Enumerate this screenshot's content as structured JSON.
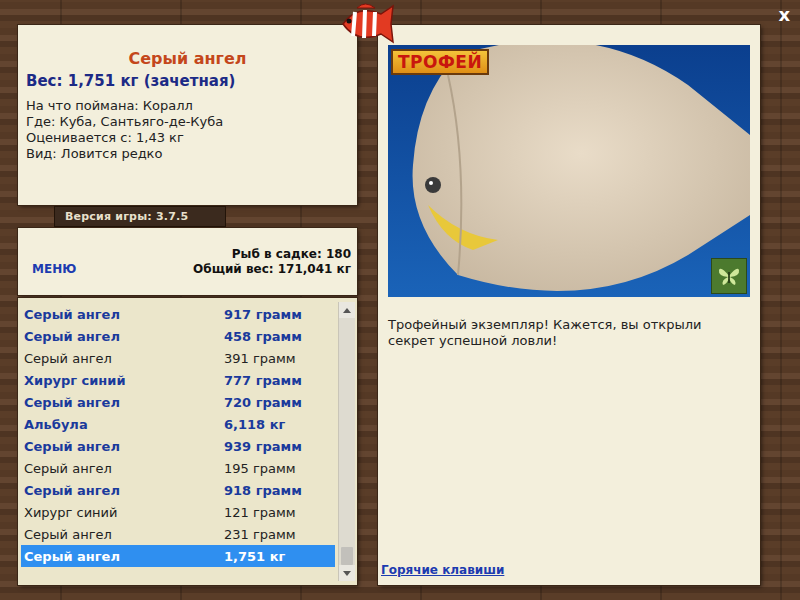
{
  "window": {
    "close": "x"
  },
  "catch": {
    "title": "Серый ангел",
    "weight": "Вес: 1,751 кг (зачетная)",
    "details": [
      "На что поймана: Коралл",
      "Где: Куба, Сантьяго-де-Куба",
      "Оценивается с: 1,43 кг",
      "Вид: Ловится редко"
    ]
  },
  "version": "Версия игры: 3.7.5",
  "menu": "МЕНЮ",
  "summary": [
    "Рыб в садке: 180",
    "Общий вес: 171,041 кг"
  ],
  "catches": [
    {
      "name": "Серый ангел",
      "weight": "917 грамм",
      "counted": true,
      "selected": false
    },
    {
      "name": "Серый ангел",
      "weight": "458 грамм",
      "counted": true,
      "selected": false
    },
    {
      "name": "Серый ангел",
      "weight": "391 грамм",
      "counted": false,
      "selected": false
    },
    {
      "name": "Хирург синий",
      "weight": "777 грамм",
      "counted": true,
      "selected": false
    },
    {
      "name": "Серый ангел",
      "weight": "720 грамм",
      "counted": true,
      "selected": false
    },
    {
      "name": "Альбула",
      "weight": "6,118 кг",
      "counted": true,
      "selected": false
    },
    {
      "name": "Серый ангел",
      "weight": "939 грамм",
      "counted": true,
      "selected": false
    },
    {
      "name": "Серый ангел",
      "weight": "195 грамм",
      "counted": false,
      "selected": false
    },
    {
      "name": "Серый ангел",
      "weight": "918 грамм",
      "counted": true,
      "selected": false
    },
    {
      "name": "Хирург синий",
      "weight": "121 грамм",
      "counted": false,
      "selected": false
    },
    {
      "name": "Серый ангел",
      "weight": "231 грамм",
      "counted": false,
      "selected": false
    },
    {
      "name": "Серый ангел",
      "weight": "1,751 кг",
      "counted": true,
      "selected": true
    }
  ],
  "scrollbar": {
    "level": 1
  },
  "photo": {
    "badge": "ТРОФЕЙ"
  },
  "message": "Трофейный экземпляр! Кажется, вы открыли секрет успешной ловли!",
  "hotkeys": "Горячие клавиши"
}
